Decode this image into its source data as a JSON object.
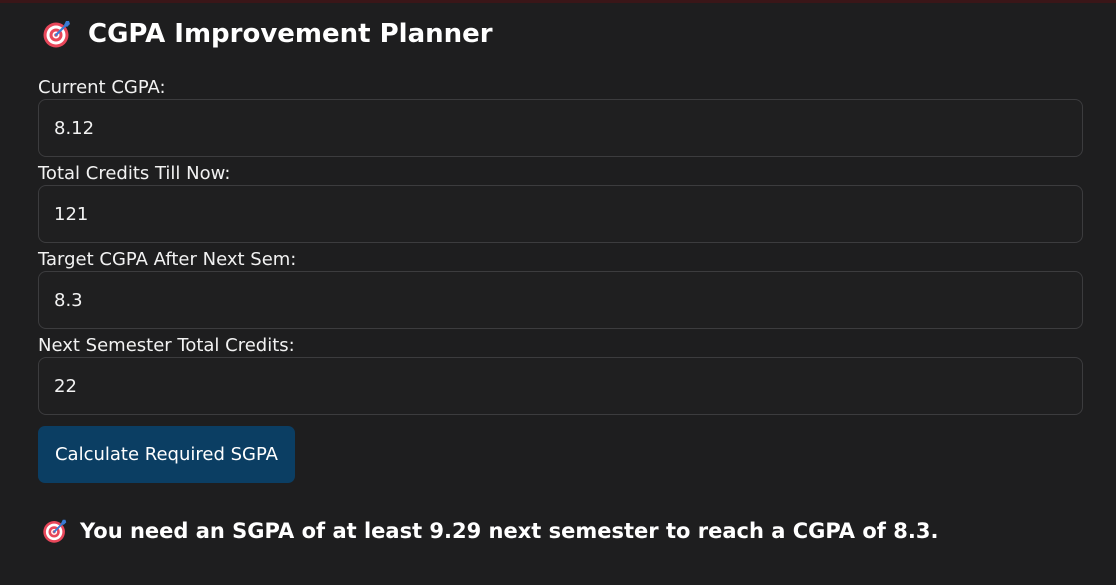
{
  "header": {
    "icon": "direct-hit-target-icon",
    "title": "CGPA Improvement Planner"
  },
  "form": {
    "current_cgpa": {
      "label": "Current CGPA:",
      "value": "8.12"
    },
    "total_credits": {
      "label": "Total Credits Till Now:",
      "value": "121"
    },
    "target_cgpa": {
      "label": "Target CGPA After Next Sem:",
      "value": "8.3"
    },
    "next_credits": {
      "label": "Next Semester Total Credits:",
      "value": "22"
    },
    "calculate_label": "Calculate Required SGPA"
  },
  "result": {
    "icon": "direct-hit-target-icon",
    "text": "You need an SGPA of at least 9.29 next semester to reach a CGPA of 8.3."
  },
  "colors": {
    "background": "#1e1e1f",
    "button": "#0b3e63",
    "target_red": "#e8475a",
    "dart_blue": "#3a7bd5"
  }
}
